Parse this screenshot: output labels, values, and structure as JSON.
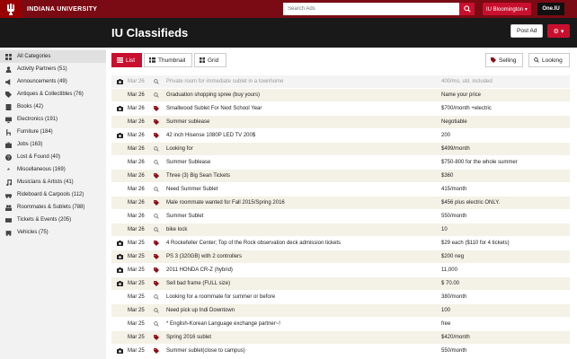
{
  "topbar": {
    "brand": "INDIANA UNIVERSITY",
    "search_placeholder": "Search Ads",
    "campus": "IU Bloomington ▾",
    "one_iu": "One.IU"
  },
  "header": {
    "title": "IU Classifieds",
    "post_ad": "Post Ad",
    "gear": "⚙ ▾"
  },
  "sidebar": {
    "items": [
      {
        "label": "All Categories",
        "icon": "grid-icon"
      },
      {
        "label": "Activity Partners (51)",
        "icon": "person-icon"
      },
      {
        "label": "Announcements (49)",
        "icon": "megaphone-icon"
      },
      {
        "label": "Antiques & Collectibles (76)",
        "icon": "tag-icon"
      },
      {
        "label": "Books (42)",
        "icon": "book-icon"
      },
      {
        "label": "Electronics (191)",
        "icon": "monitor-icon"
      },
      {
        "label": "Furniture (184)",
        "icon": "chair-icon"
      },
      {
        "label": "Jobs (163)",
        "icon": "briefcase-icon"
      },
      {
        "label": "Lost & Found (40)",
        "icon": "question-icon"
      },
      {
        "label": "Miscellaneous (169)",
        "icon": "asterisk-icon"
      },
      {
        "label": "Musicians & Artists (41)",
        "icon": "music-icon"
      },
      {
        "label": "Rideboard & Carpools (112)",
        "icon": "car-icon"
      },
      {
        "label": "Roommates & Sublets (788)",
        "icon": "people-icon"
      },
      {
        "label": "Tickets & Events (205)",
        "icon": "ticket-icon"
      },
      {
        "label": "Vehicles (75)",
        "icon": "vehicle-icon"
      }
    ]
  },
  "views": {
    "list": "List",
    "thumbnail": "Thumbnail",
    "grid": "Grid",
    "selling": "Selling",
    "looking": "Looking"
  },
  "listings": [
    {
      "date": "Mar 26",
      "title": "Private room for immediate sublet in a townhome",
      "price": "400/mo, util. included",
      "cam": true,
      "sale": false
    },
    {
      "date": "Mar 26",
      "title": "Graduation shopping spree (buy yours)",
      "price": "Name your price",
      "cam": false,
      "sale": false
    },
    {
      "date": "Mar 26",
      "title": "Smallwood Sublet For Next School Year",
      "price": "$700/month +electric",
      "cam": true,
      "sale": true
    },
    {
      "date": "Mar 26",
      "title": "Summer sublease",
      "price": "Negotiable",
      "cam": false,
      "sale": true
    },
    {
      "date": "Mar 26",
      "title": "42 inch Hisense 1080P LED TV 200$",
      "price": "200",
      "cam": true,
      "sale": true
    },
    {
      "date": "Mar 26",
      "title": "Looking for",
      "price": "$499/month",
      "cam": false,
      "sale": false
    },
    {
      "date": "Mar 26",
      "title": "Summer Sublease",
      "price": "$750-800 for the whole summer",
      "cam": false,
      "sale": false
    },
    {
      "date": "Mar 26",
      "title": "Three (3) Big Sean Tickets",
      "price": "$360",
      "cam": false,
      "sale": true
    },
    {
      "date": "Mar 26",
      "title": "Need Summer Sublet",
      "price": "415/month",
      "cam": false,
      "sale": false
    },
    {
      "date": "Mar 26",
      "title": "Male roommate wanted for Fall 2015/Spring 2016",
      "price": "$456 plus electric ONLY.",
      "cam": false,
      "sale": true
    },
    {
      "date": "Mar 26",
      "title": "Summer Sublet",
      "price": "550/month",
      "cam": false,
      "sale": false
    },
    {
      "date": "Mar 26",
      "title": "bike lock",
      "price": "10",
      "cam": false,
      "sale": false
    },
    {
      "date": "Mar 25",
      "title": "4 Rockefeller Center; Top of the Rock observation deck admission tickets",
      "price": "$29 each ($110 for 4 tickets)",
      "cam": true,
      "sale": true
    },
    {
      "date": "Mar 25",
      "title": "PS 3 (320GB) with 2 controllers",
      "price": "$200 neg",
      "cam": true,
      "sale": true
    },
    {
      "date": "Mar 25",
      "title": "2011 HONDA CR-Z (hybrid)",
      "price": "11,000",
      "cam": true,
      "sale": true
    },
    {
      "date": "Mar 25",
      "title": "Sell bad frame (FULL size)",
      "price": "$ 70.00",
      "cam": true,
      "sale": true
    },
    {
      "date": "Mar 25",
      "title": "Looking for a roommate for summer or before",
      "price": "380/month",
      "cam": false,
      "sale": false
    },
    {
      "date": "Mar 25",
      "title": "Need pick up Indi Downtown",
      "price": "100",
      "cam": false,
      "sale": false
    },
    {
      "date": "Mar 25",
      "title": "* English-Korean Language exchange partner~!",
      "price": "free",
      "cam": false,
      "sale": false
    },
    {
      "date": "Mar 25",
      "title": "Spring 2016 sublet",
      "price": "$420/month",
      "cam": false,
      "sale": true
    },
    {
      "date": "Mar 25",
      "title": "Summer sublet(close to campus)",
      "price": "550/month",
      "cam": true,
      "sale": true
    }
  ]
}
